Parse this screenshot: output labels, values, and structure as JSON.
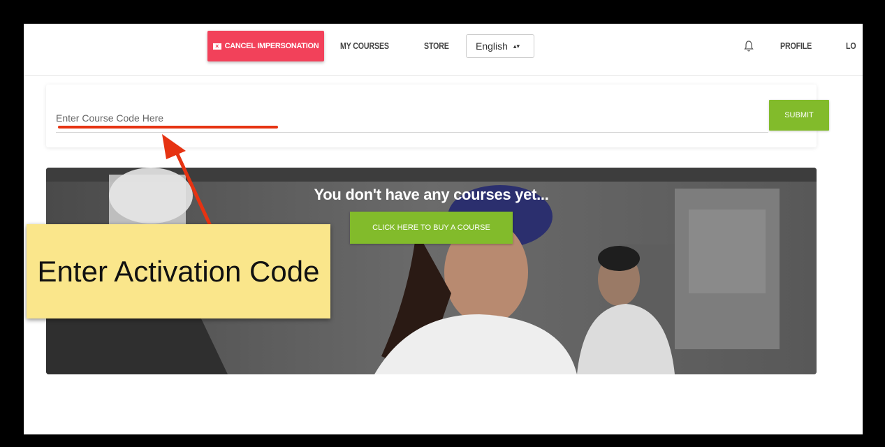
{
  "navbar": {
    "cancel_impersonation": "CANCEL IMPERSONATION",
    "my_courses": "MY COURSES",
    "store": "STORE",
    "language": "English",
    "profile": "PROFILE",
    "logout_partial": "LO"
  },
  "course_code": {
    "placeholder": "Enter Course Code Here",
    "submit_label": "SUBMIT"
  },
  "hero": {
    "title": "You don't have any courses yet...",
    "buy_label": "CLICK HERE TO BUY A COURSE"
  },
  "annotation": {
    "text": "Enter Activation Code"
  },
  "colors": {
    "cancel_red": "#f2415a",
    "button_green": "#82bb2b",
    "annotation_red": "#e63312",
    "callout_yellow": "#fae68b"
  }
}
